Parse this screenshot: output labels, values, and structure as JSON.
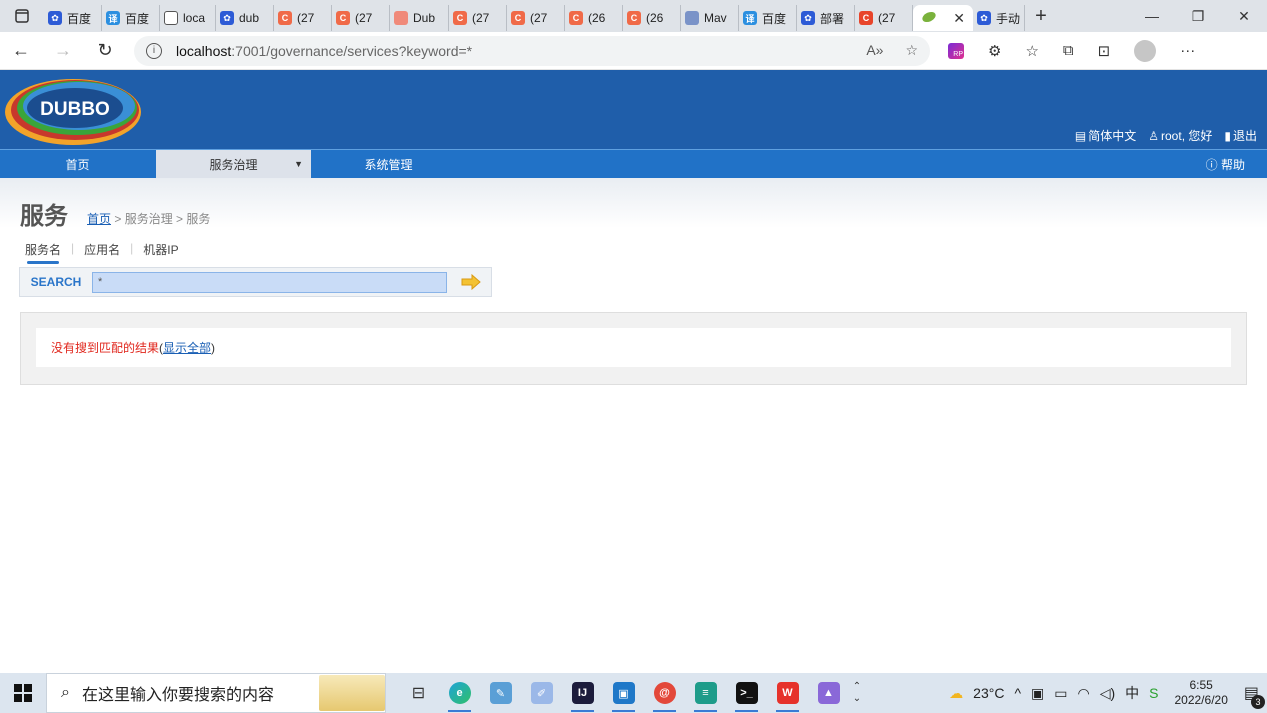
{
  "browser": {
    "tabs": [
      {
        "label": "百度",
        "icon": "paw-icon",
        "color": "#2d5bd6"
      },
      {
        "label": "百度",
        "icon": "translate-icon",
        "color": "#2b8fe0"
      },
      {
        "label": "loca",
        "icon": "page-icon",
        "color": "#ffffff"
      },
      {
        "label": "dub",
        "icon": "paw-icon",
        "color": "#2d5bd6"
      },
      {
        "label": "(27",
        "icon": "csdn-icon",
        "color": "#f06a48"
      },
      {
        "label": "(27",
        "icon": "csdn-icon",
        "color": "#f06a48"
      },
      {
        "label": "Dub",
        "icon": "doc-icon",
        "color": "#f08a7a"
      },
      {
        "label": "(27",
        "icon": "csdn-icon",
        "color": "#f06a48"
      },
      {
        "label": "(27",
        "icon": "csdn-icon",
        "color": "#f06a48"
      },
      {
        "label": "(26",
        "icon": "csdn-icon",
        "color": "#f06a48"
      },
      {
        "label": "(26",
        "icon": "csdn-icon",
        "color": "#f06a48"
      },
      {
        "label": "Mav",
        "icon": "mvn-icon",
        "color": "#7a93c8"
      },
      {
        "label": "百度",
        "icon": "translate-icon",
        "color": "#2b8fe0"
      },
      {
        "label": "部署",
        "icon": "paw-icon",
        "color": "#2d5bd6"
      },
      {
        "label": "(27",
        "icon": "csdn-icon",
        "color": "#e8442a"
      }
    ],
    "active_tab": {
      "icon": "leaf-icon",
      "close": "✕"
    },
    "trailing_tab": {
      "label": "手动",
      "icon": "paw-icon"
    },
    "url_host": "localhost",
    "url_path": ":7001/governance/services?keyword=*"
  },
  "header": {
    "logo_text": "DUBBO",
    "lang_link": "简体中文",
    "user_greeting": "root, 您好",
    "logout": "退出"
  },
  "nav": {
    "items": [
      "首页",
      "服务治理",
      "系统管理"
    ],
    "help": "帮助"
  },
  "page": {
    "title": "服务",
    "breadcrumb_home": "首页",
    "breadcrumb_rest": " > 服务治理 > 服务",
    "subtabs": [
      "服务名",
      "应用名",
      "机器IP"
    ],
    "search_label": "SEARCH",
    "search_value": "*",
    "no_result": "没有搜到匹配的结果",
    "show_all_open": " (",
    "show_all": "显示全部",
    "show_all_close": ")"
  },
  "taskbar": {
    "search_placeholder": "在这里输入你要搜索的内容",
    "weather": "23°C",
    "ime": "中",
    "time": "6:55",
    "date": "2022/6/20",
    "notifications": "3"
  }
}
